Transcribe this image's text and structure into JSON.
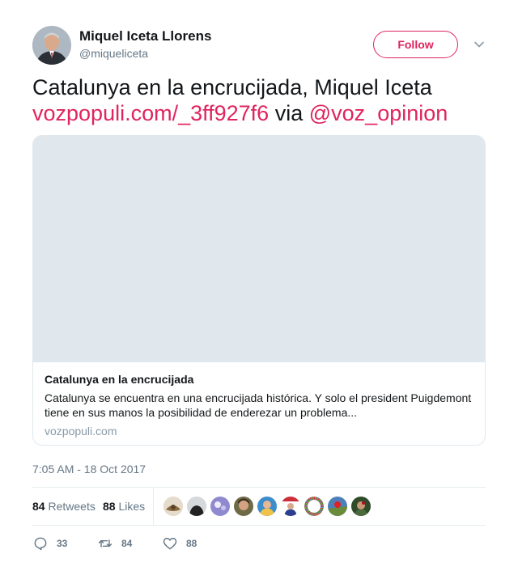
{
  "author": {
    "display_name": "Miquel Iceta Llorens",
    "handle": "@miqueliceta",
    "avatar_icon": "profile-photo"
  },
  "follow_label": "Follow",
  "tweet": {
    "text_plain_1": "Catalunya en la encrucijada, Miquel Iceta",
    "link_text": "vozpopuli.com/_3ff927f6",
    "text_plain_2": "via",
    "mention_text": "@voz_opinion",
    "accent_color": "#e0245e"
  },
  "card": {
    "title": "Catalunya en la encrucijada",
    "description": "Catalunya se encuentra en una encrucijada histórica. Y solo el president Puigdemont tiene en sus manos la posibilidad de enderezar un problema...",
    "domain": "vozpopuli.com"
  },
  "timestamp": "7:05 AM - 18 Oct 2017",
  "stats": {
    "retweets_count": "84",
    "retweets_label": "Retweets",
    "likes_count": "88",
    "likes_label": "Likes"
  },
  "actions": {
    "reply_count": "33",
    "retweet_count": "84",
    "like_count": "88"
  }
}
